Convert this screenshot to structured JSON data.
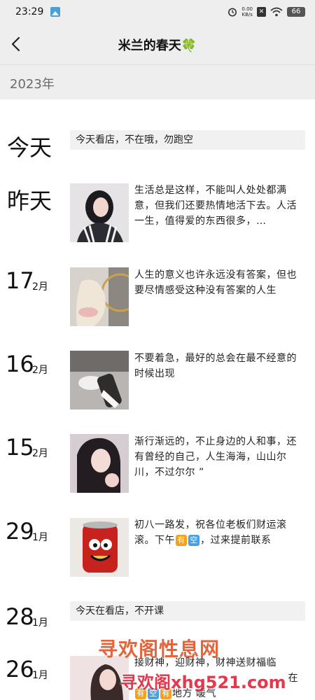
{
  "status_bar": {
    "time": "23:29",
    "speed_value": "0.00",
    "speed_unit": "KB/s",
    "battery": "66"
  },
  "header": {
    "title": "米兰的春天🍀"
  },
  "year_label": "2023年",
  "entries": [
    {
      "date": "今天",
      "text": "今天看店，不在哦，勿跑空"
    },
    {
      "date": "昨天",
      "text": "生活总是这样，不能叫人处处都满意，但我们还要热情地活下去。人活一生，值得爱的东西很多，…"
    },
    {
      "day": "17",
      "month": "2月",
      "text": "人生的意义也许永远没有答案，但也要尽情感受这种没有答案的人生"
    },
    {
      "day": "16",
      "month": "2月",
      "text": "不要着急，最好的总会在最不经意的时候出现"
    },
    {
      "day": "15",
      "month": "2月",
      "text": "渐行渐远的，不止身边的人和事，还有曾经的自己，人生海海，山山尔川，不过尔尔 ”"
    },
    {
      "day": "29",
      "month": "1月",
      "text_before": "初八一路发，祝各位老板们财运滚滚。下午",
      "emoji_1": "有",
      "emoji_2": "空",
      "text_after": "，过来提前联系"
    },
    {
      "day": "28",
      "month": "1月",
      "text": "今天在看店，不开课"
    },
    {
      "day": "26",
      "month": "1月",
      "text_line_1": "接财神，迎财神，财神送财福临",
      "text_line_2": "在",
      "text_line_3": "地方",
      "text_line_4": "暖气",
      "emoji_1": "有",
      "emoji_2": "空",
      "emoji_3": "有"
    }
  ],
  "watermark": {
    "line_1": "寻欢阁性息网",
    "line_2": "寻欢阁xhg521.com"
  },
  "colors": {
    "bar_background": "#eeeeee",
    "card_background": "#f1f1f1",
    "emoji_orange": "#f4a21d",
    "emoji_blue": "#4a9fe0",
    "watermark": "#e0233a"
  }
}
